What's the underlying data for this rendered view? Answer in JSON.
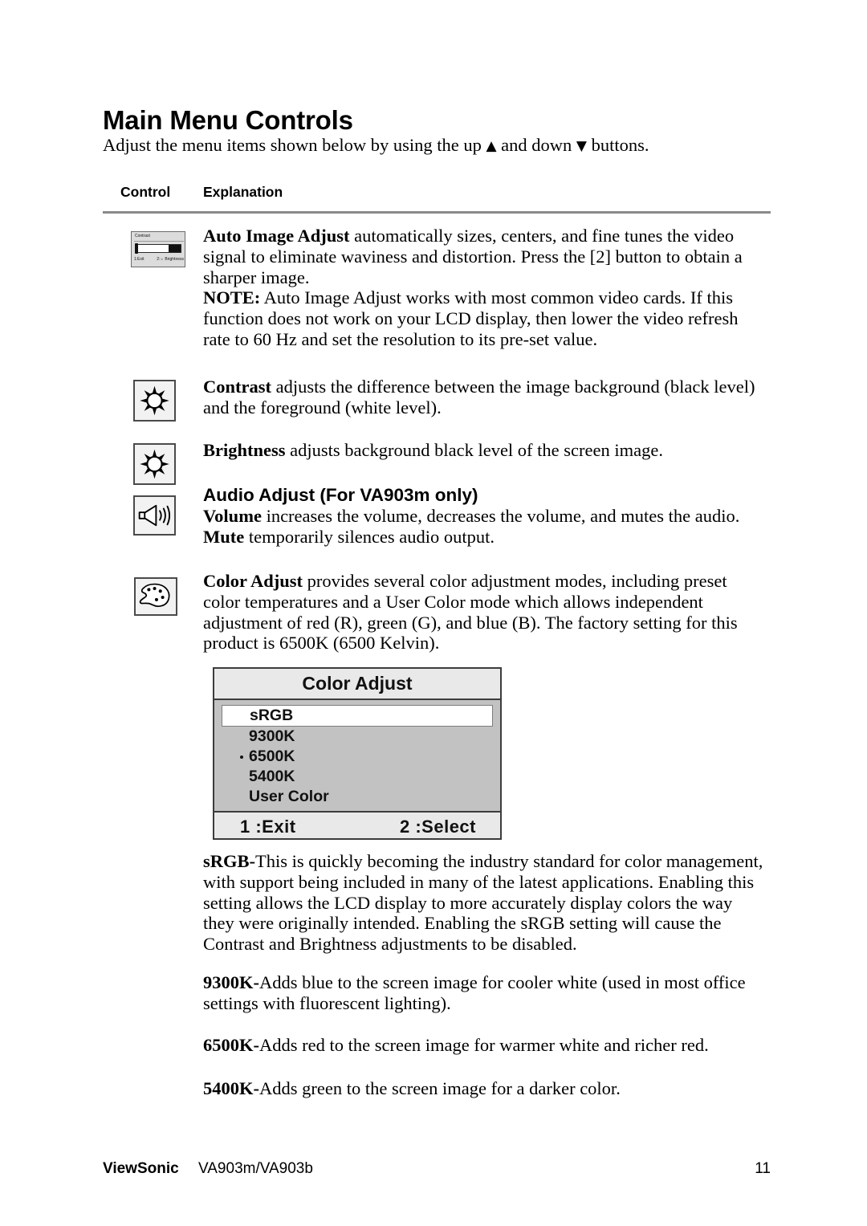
{
  "document": {
    "title": "Main Menu Controls",
    "intro_before": "Adjust the menu items shown below by using the up ",
    "intro_up_glyph": "▲",
    "intro_middle": " and down ",
    "intro_down_glyph": "▼",
    "intro_after": " buttons."
  },
  "table_headers": {
    "control": "Control",
    "explanation": "Explanation"
  },
  "osd_thumbnail": {
    "title": "Contrast",
    "exit_label": "1:Exit",
    "brightness_label": "2:☼ Brightness"
  },
  "entries": {
    "auto_image_adjust": {
      "icon": "osd-contrast-thumbnail-icon",
      "term": "Auto Image Adjust",
      "body": " automatically sizes, centers, and fine tunes the video signal to eliminate waviness and distortion. Press the [2] button to obtain a sharper image.",
      "note_term": "NOTE:",
      "note_body": " Auto Image Adjust works with most common video cards. If this function does not work on your LCD display, then lower the video refresh rate to 60 Hz and set the resolution to its pre-set value."
    },
    "contrast": {
      "icon": "brightness-sun-icon",
      "term": "Contrast",
      "body": " adjusts the difference between the image background  (black level) and the foreground (white level)."
    },
    "brightness": {
      "icon": "brightness-sun-icon",
      "term": "Brightness",
      "body": " adjusts background black level of the screen image."
    },
    "audio_adjust": {
      "icon": "speaker-volume-icon",
      "heading": "Audio Adjust (For VA903m only)",
      "volume_term": "Volume",
      "volume_body": " increases the volume, decreases the volume, and mutes the audio.",
      "mute_term": "Mute",
      "mute_body": " temporarily silences audio output."
    },
    "color_adjust": {
      "icon": "color-palette-icon",
      "term": "Color Adjust",
      "body": " provides several color adjustment modes, including preset color temperatures and a User Color mode which allows independent adjustment of red (R), green (G), and blue (B). The factory setting for this product is 6500K (6500 Kelvin)."
    }
  },
  "color_adjust_osd": {
    "title": "Color Adjust",
    "items": [
      {
        "label": "sRGB",
        "selected": true,
        "marked": false
      },
      {
        "label": "9300K",
        "selected": false,
        "marked": false
      },
      {
        "label": "6500K",
        "selected": false,
        "marked": true
      },
      {
        "label": "5400K",
        "selected": false,
        "marked": false
      },
      {
        "label": "User Color",
        "selected": false,
        "marked": false
      }
    ],
    "exit_label": "1 :Exit",
    "select_label": "2 :Select",
    "colors": {
      "header_bg": "#e9e9e9",
      "body_bg": "#c2c2c2",
      "footer_bg": "#e9e9e9",
      "border": "#3c3c3c",
      "selected_bg": "#ffffff"
    }
  },
  "descriptions": {
    "srgb": {
      "term": "sRGB-",
      "body": "This is quickly becoming the industry standard for color management, with support being included in many of the latest applications. Enabling this setting allows the LCD display to more accurately display colors the way they were originally intended. Enabling the sRGB setting will cause the Contrast and Brightness adjustments to be disabled."
    },
    "k9300": {
      "term": "9300K-",
      "body": "Adds blue to the screen image for cooler white (used in most office settings with fluorescent lighting)."
    },
    "k6500": {
      "term": "6500K-",
      "body": "Adds red to the screen image for warmer white and richer red."
    },
    "k5400": {
      "term": "5400K-",
      "body": "Adds green to the screen image for a darker color."
    }
  },
  "footer": {
    "brand": "ViewSonic",
    "model": "VA903m/VA903b",
    "page_number": "11"
  }
}
